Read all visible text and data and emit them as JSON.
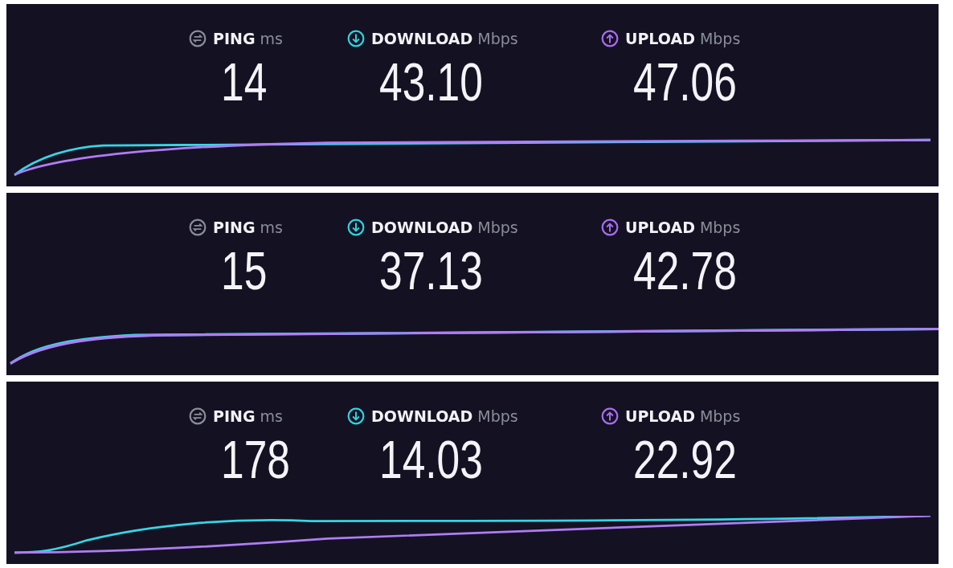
{
  "results": [
    {
      "metrics": [
        {
          "kind": "ping",
          "label": "PING",
          "unit": "ms",
          "value": "14"
        },
        {
          "kind": "download",
          "label": "DOWNLOAD",
          "unit": "Mbps",
          "value": "43.10"
        },
        {
          "kind": "upload",
          "label": "UPLOAD",
          "unit": "Mbps",
          "value": "47.06"
        }
      ]
    },
    {
      "metrics": [
        {
          "kind": "ping",
          "label": "PING",
          "unit": "ms",
          "value": "15"
        },
        {
          "kind": "download",
          "label": "DOWNLOAD",
          "unit": "Mbps",
          "value": "37.13"
        },
        {
          "kind": "upload",
          "label": "UPLOAD",
          "unit": "Mbps",
          "value": "42.78"
        }
      ]
    },
    {
      "metrics": [
        {
          "kind": "ping",
          "label": "PING",
          "unit": "ms",
          "value": "178"
        },
        {
          "kind": "download",
          "label": "DOWNLOAD",
          "unit": "Mbps",
          "value": "14.03"
        },
        {
          "kind": "upload",
          "label": "UPLOAD",
          "unit": "Mbps",
          "value": "22.92"
        }
      ]
    }
  ]
}
